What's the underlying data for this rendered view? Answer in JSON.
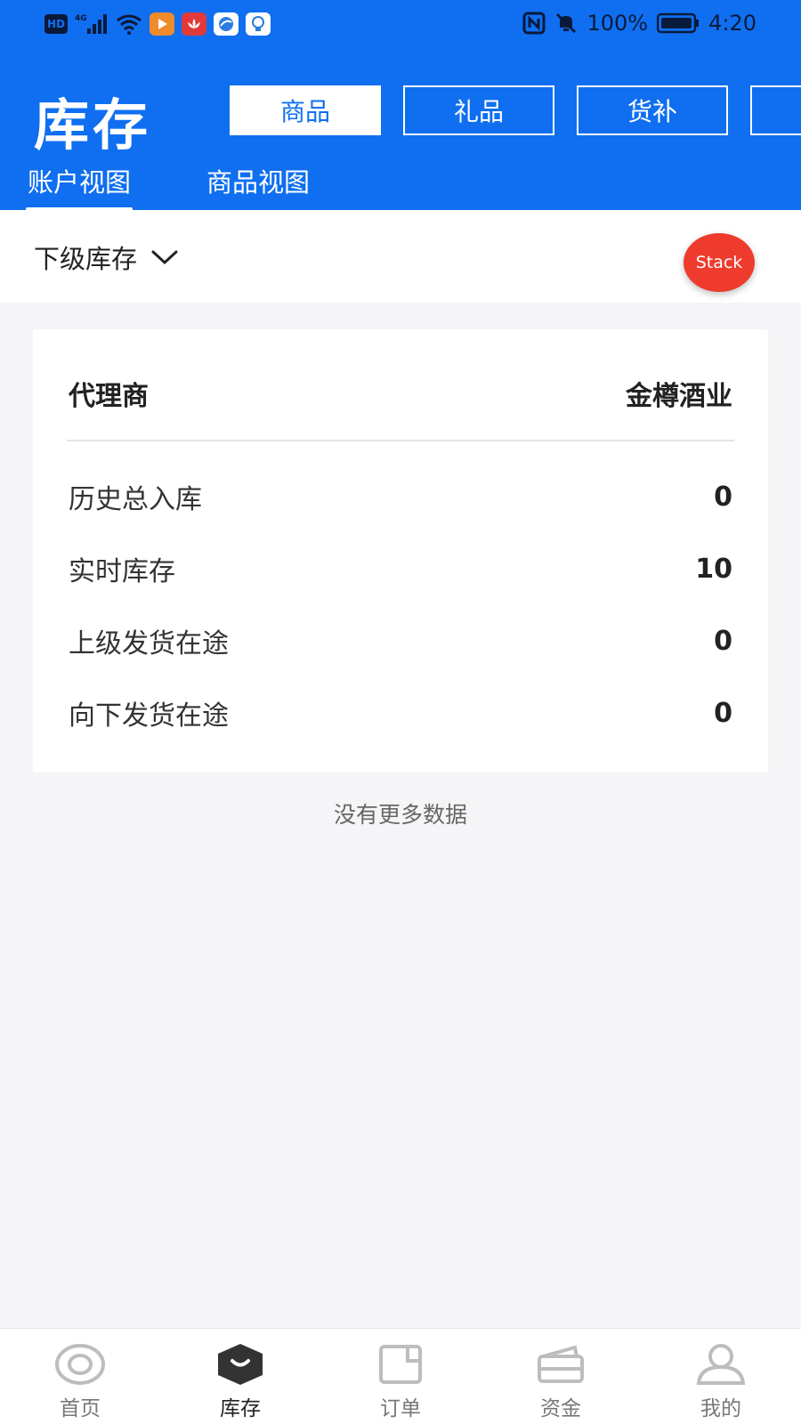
{
  "status_bar": {
    "battery": "100%",
    "time": "4:20",
    "network": "4G"
  },
  "header": {
    "title": "库存",
    "segments": [
      {
        "label": "商品",
        "active": true
      },
      {
        "label": "礼品",
        "active": false
      },
      {
        "label": "货补",
        "active": false
      },
      {
        "label": "",
        "active": false
      }
    ],
    "view_tabs": [
      {
        "label": "账户视图",
        "active": true
      },
      {
        "label": "商品视图",
        "active": false
      }
    ]
  },
  "filter": {
    "label": "下级库存",
    "stack_button": "Stack"
  },
  "card": {
    "head_label": "代理商",
    "head_value": "金樽酒业",
    "rows": [
      {
        "label": "历史总入库",
        "value": "0"
      },
      {
        "label": "实时库存",
        "value": "10"
      },
      {
        "label": "上级发货在途",
        "value": "0"
      },
      {
        "label": "向下发货在途",
        "value": "0"
      }
    ]
  },
  "list_footer": "没有更多数据",
  "bottom_nav": [
    {
      "label": "首页",
      "icon": "home-icon",
      "active": false
    },
    {
      "label": "库存",
      "icon": "inventory-icon",
      "active": true
    },
    {
      "label": "订单",
      "icon": "order-icon",
      "active": false
    },
    {
      "label": "资金",
      "icon": "wallet-icon",
      "active": false
    },
    {
      "label": "我的",
      "icon": "profile-icon",
      "active": false
    }
  ],
  "colors": {
    "primary": "#0f6ff0",
    "stack_red": "#ef3b2d",
    "background": "#f5f5f7"
  }
}
